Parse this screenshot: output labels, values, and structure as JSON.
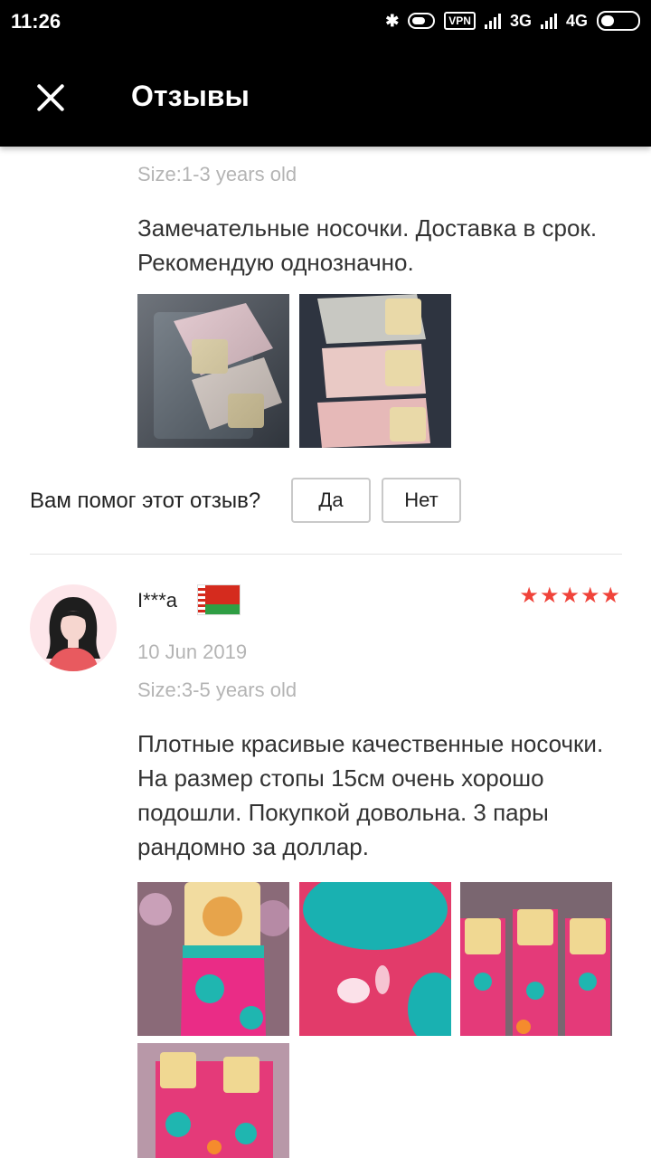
{
  "status_bar": {
    "time": "11:26",
    "vpn": "VPN",
    "net1": "3G",
    "net2": "4G"
  },
  "header": {
    "title": "Отзывы"
  },
  "review1": {
    "size": "Size:1-3 years old",
    "text": "Замечательные носочки. Доставка в срок. Рекомендую однозначно.",
    "photos": [
      "socks-pink-white-pack",
      "socks-gray-pink-pack"
    ]
  },
  "helpful": {
    "question": "Вам помог этот отзыв?",
    "yes": "Да",
    "no": "Нет"
  },
  "review2": {
    "user": "I***a",
    "country_flag": "belarus-flag",
    "rating": 5,
    "stars": "★★★★★",
    "date": "10 Jun 2019",
    "size": "Size:3-5 years old",
    "text": "Плотные красивые качественные носочки.  На размер стопы 15см очень хорошо подошли. Покупкой довольна. 3 пары рандомно за доллар.",
    "photos": [
      "pink-sock-with-label",
      "sock-closeup-pattern",
      "three-socks-packs",
      "socks-pack-fourth"
    ]
  },
  "colors": {
    "accent_star": "#f0433a",
    "muted_text": "#b4b4b4"
  }
}
